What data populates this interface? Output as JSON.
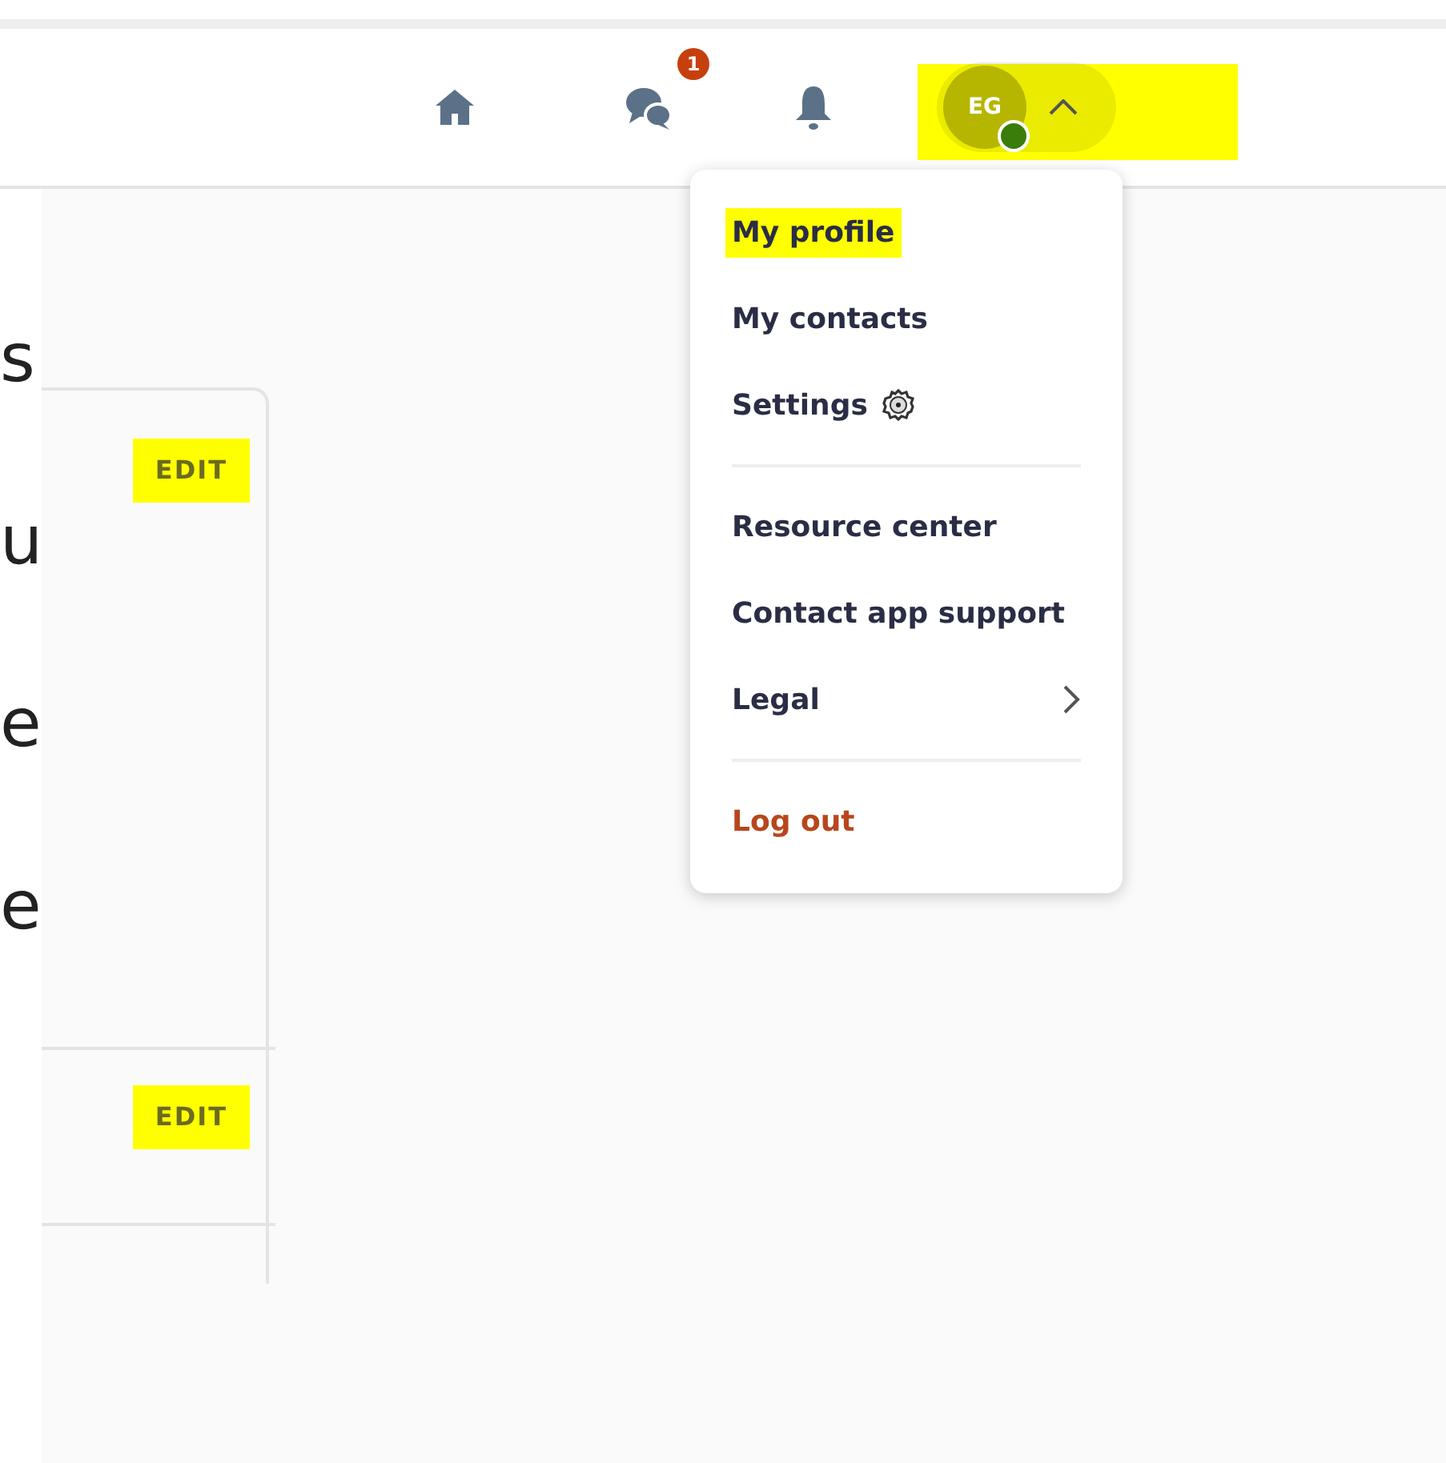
{
  "header": {
    "icons": [
      {
        "kind": "home"
      },
      {
        "kind": "chat",
        "badge": "1"
      },
      {
        "kind": "bell"
      }
    ],
    "profile": {
      "initials": "EG",
      "online": true,
      "expanded": true,
      "highlighted": true
    }
  },
  "menu": [
    {
      "kind": "item",
      "label": "My profile",
      "highlighted": true
    },
    {
      "kind": "item",
      "label": "My contacts",
      "highlighted": false
    },
    {
      "kind": "settings",
      "label": "Settings",
      "highlighted": false
    },
    {
      "kind": "divider"
    },
    {
      "kind": "item",
      "label": "Resource center",
      "highlighted": false
    },
    {
      "kind": "item",
      "label": "Contact app support",
      "highlighted": false
    },
    {
      "kind": "submenu",
      "label": "Legal",
      "highlighted": false
    },
    {
      "kind": "divider"
    },
    {
      "kind": "danger",
      "label": "Log out",
      "highlighted": false
    }
  ],
  "left_text": [
    "s",
    "u",
    "e",
    "e"
  ],
  "card": {
    "edit_buttons": [
      {
        "label": "EDIT",
        "highlighted": true
      },
      {
        "label": "EDIT",
        "highlighted": true
      }
    ]
  }
}
